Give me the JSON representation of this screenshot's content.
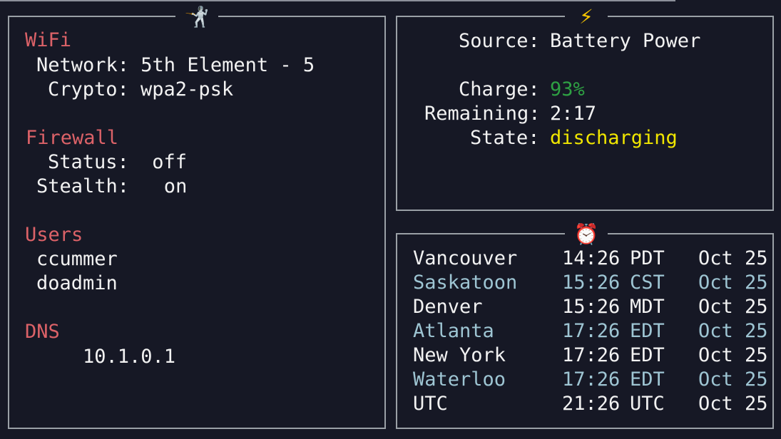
{
  "left_panel": {
    "icon": "fencer-icon",
    "icon_glyph": "🤺",
    "wifi": {
      "heading": "WiFi",
      "network_line": "Network: 5th Element - 5",
      "crypto_line": "Crypto: wpa2-psk"
    },
    "firewall": {
      "heading": "Firewall",
      "status_line": "Status:  off",
      "stealth_line": "Stealth:   on"
    },
    "users": {
      "heading": "Users",
      "list": [
        "ccummer",
        "doadmin"
      ]
    },
    "dns": {
      "heading": "DNS",
      "value": "10.1.0.1"
    }
  },
  "power_panel": {
    "icon": "lightning-bolt-icon",
    "icon_glyph": "⚡",
    "source_label": "Source:",
    "source_value": "Battery Power",
    "charge_label": "Charge:",
    "charge_value": "93%",
    "remaining_label": "Remaining:",
    "remaining_value": "2:17",
    "state_label": "State:",
    "state_value": "discharging",
    "colors": {
      "charge": "#2ea043",
      "state": "#f0e600"
    }
  },
  "clock_panel": {
    "icon": "alarm-clock-icon",
    "icon_glyph": "⏰",
    "rows": [
      {
        "city": "Vancouver",
        "time": "14:26",
        "tz": "PDT",
        "date": "Oct 25",
        "highlight": false
      },
      {
        "city": "Saskatoon",
        "time": "15:26",
        "tz": "CST",
        "date": "Oct 25",
        "highlight": true
      },
      {
        "city": "Denver",
        "time": "15:26",
        "tz": "MDT",
        "date": "Oct 25",
        "highlight": false
      },
      {
        "city": "Atlanta",
        "time": "17:26",
        "tz": "EDT",
        "date": "Oct 25",
        "highlight": true
      },
      {
        "city": "New York",
        "time": "17:26",
        "tz": "EDT",
        "date": "Oct 25",
        "highlight": false
      },
      {
        "city": "Waterloo",
        "time": "17:26",
        "tz": "EDT",
        "date": "Oct 25",
        "highlight": true
      },
      {
        "city": "UTC",
        "time": "21:26",
        "tz": "UTC",
        "date": "Oct 25",
        "highlight": false
      }
    ],
    "colors": {
      "highlight": "#9ec5d3",
      "normal": "#f2f2f2"
    }
  }
}
